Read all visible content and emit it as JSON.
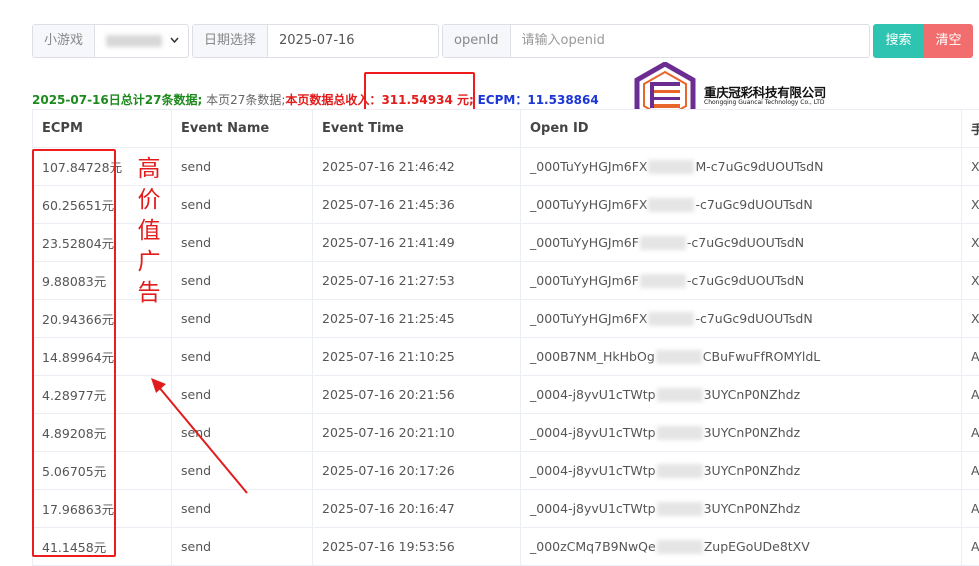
{
  "filters": {
    "game": {
      "label": "小游戏"
    },
    "date": {
      "label": "日期选择",
      "value": "2025-07-16"
    },
    "openid": {
      "label": "openId",
      "placeholder": "请输入openid"
    },
    "search_label": "搜索",
    "clear_label": "清空"
  },
  "summary": {
    "total": "2025-07-16日总计27条数据;",
    "page_count": "本页27条数据;",
    "revenue_label": "本页数据总收入：",
    "revenue_value": "311.54934 元;",
    "ecpm_label": "ECPM：",
    "ecpm_value": "11.538864"
  },
  "logo": {
    "name": "重庆冠彩科技有限公司",
    "subtitle": "Chongqing Guancai Technology Co., LTD"
  },
  "table": {
    "columns": [
      "ECPM",
      "Event Name",
      "Event Time",
      "Open ID",
      "手"
    ],
    "rows": [
      {
        "ecpm": "107.84728元",
        "event": "send",
        "time": "2025-07-16 21:46:42",
        "oid_a": "_000TuYyHGJm6FX",
        "oid_b": "M-c7uGc9dUOUTsdN",
        "extra": "X"
      },
      {
        "ecpm": "60.25651元",
        "event": "send",
        "time": "2025-07-16 21:45:36",
        "oid_a": "_000TuYyHGJm6FX",
        "oid_b": "-c7uGc9dUOUTsdN",
        "extra": "X"
      },
      {
        "ecpm": "23.52804元",
        "event": "send",
        "time": "2025-07-16 21:41:49",
        "oid_a": "_000TuYyHGJm6F",
        "oid_b": "-c7uGc9dUOUTsdN",
        "extra": "X"
      },
      {
        "ecpm": "9.88083元",
        "event": "send",
        "time": "2025-07-16 21:27:53",
        "oid_a": "_000TuYyHGJm6F",
        "oid_b": "-c7uGc9dUOUTsdN",
        "extra": "X"
      },
      {
        "ecpm": "20.94366元",
        "event": "send",
        "time": "2025-07-16 21:25:45",
        "oid_a": "_000TuYyHGJm6FX",
        "oid_b": "-c7uGc9dUOUTsdN",
        "extra": "X"
      },
      {
        "ecpm": "14.89964元",
        "event": "send",
        "time": "2025-07-16 21:10:25",
        "oid_a": "_000B7NM_HkHbOg",
        "oid_b": "CBuFwuFfROMYldL",
        "extra": "A"
      },
      {
        "ecpm": "4.28977元",
        "event": "send",
        "time": "2025-07-16 20:21:56",
        "oid_a": "_0004-j8yvU1cTWtp",
        "oid_b": "3UYCnP0NZhdz",
        "extra": "A"
      },
      {
        "ecpm": "4.89208元",
        "event": "send",
        "time": "2025-07-16 20:21:10",
        "oid_a": "_0004-j8yvU1cTWtp",
        "oid_b": "3UYCnP0NZhdz",
        "extra": "A"
      },
      {
        "ecpm": "5.06705元",
        "event": "send",
        "time": "2025-07-16 20:17:26",
        "oid_a": "_0004-j8yvU1cTWtp",
        "oid_b": "3UYCnP0NZhdz",
        "extra": "A"
      },
      {
        "ecpm": "17.96863元",
        "event": "send",
        "time": "2025-07-16 20:16:47",
        "oid_a": "_0004-j8yvU1cTWtp",
        "oid_b": "3UYCnP0NZhdz",
        "extra": "A"
      },
      {
        "ecpm": "41.1458元",
        "event": "send",
        "time": "2025-07-16 19:53:56",
        "oid_a": "_000zCMq7B9NwQe",
        "oid_b": "ZupEGoUDe8tXV",
        "extra": "A"
      }
    ]
  },
  "annotation": {
    "chars": [
      "高",
      "价",
      "值",
      "广",
      "告"
    ]
  },
  "colors": {
    "search_button": "#2fc4b2",
    "clear_button": "#f26d6d",
    "annotation_red": "#e21c1c",
    "summary_green": "#1d8a1d",
    "summary_blue": "#1b35d6",
    "logo_purple": "#6b2d91",
    "logo_orange": "#e9662a"
  }
}
